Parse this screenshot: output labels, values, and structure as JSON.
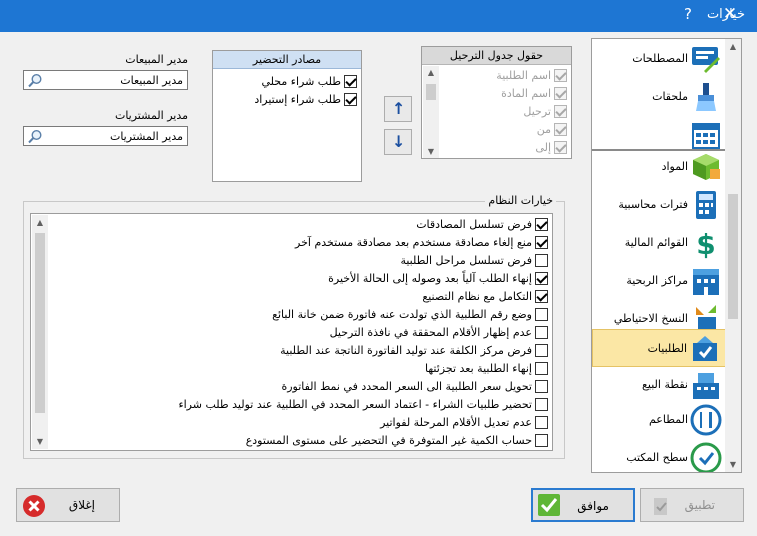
{
  "window": {
    "title": "خيارات",
    "help": "?",
    "close": "✕"
  },
  "sales_manager": {
    "label": "مدير المبيعات",
    "value": "مدير المبيعات"
  },
  "purchase_manager": {
    "label": "مدير المشتريات",
    "value": "مدير المشتريات"
  },
  "prep_sources": {
    "header": "مصادر التحضير",
    "items": [
      {
        "label": "طلب شراء محلي",
        "checked": true
      },
      {
        "label": "طلب شراء إستيراد",
        "checked": true
      }
    ]
  },
  "schedule_fields": {
    "header": "حقول جدول الترحيل",
    "items": [
      {
        "label": "اسم الطلبية",
        "checked": true
      },
      {
        "label": "اسم المادة",
        "checked": true
      },
      {
        "label": "ترحيل",
        "checked": true
      },
      {
        "label": "من",
        "checked": true
      },
      {
        "label": "إلى",
        "checked": true
      }
    ]
  },
  "arrows": {
    "up": "↑",
    "down": "↓"
  },
  "system_options": {
    "legend": "خيارات النظام",
    "items": [
      {
        "label": "فرض تسلسل المصادقات",
        "checked": true
      },
      {
        "label": "منع إلغاء مصادقة مستخدم بعد مصادقة مستخدم آخر",
        "checked": true
      },
      {
        "label": "فرض تسلسل مراحل الطلبية",
        "checked": false
      },
      {
        "label": "إنهاء الطلب آلياً بعد وصوله إلى الحالة الأخيرة",
        "checked": true
      },
      {
        "label": "التكامل مع نظام التصنيع",
        "checked": true
      },
      {
        "label": "وضع رقم الطلبية الذي تولدت عنه فاتورة ضمن خانة البائع",
        "checked": false
      },
      {
        "label": "عدم إظهار الأقلام المحققة في نافذة الترحيل",
        "checked": false
      },
      {
        "label": "فرض مركز الكلفة عند توليد الفاتورة الناتجة عند الطلبية",
        "checked": false
      },
      {
        "label": "إنهاء الطلبية بعد تجزئتها",
        "checked": false
      },
      {
        "label": "تحويل سعر الطلبية الى السعر المحدد في نمط الفاتورة",
        "checked": false
      },
      {
        "label": "تحضير طلبيات الشراء - اعتماد السعر المحدد في الطلبية عند توليد طلب شراء",
        "checked": false
      },
      {
        "label": "عدم تعديل الأقلام المرحلة لفواتير",
        "checked": false
      },
      {
        "label": "حساب الكمية غير المتوفرة في التحضير على مستوى المستودع",
        "checked": false
      }
    ]
  },
  "nav": {
    "items": [
      {
        "label": "المصطلحات",
        "icon": "terms-icon",
        "color": "#1c6fb8"
      },
      {
        "label": "ملحقات",
        "icon": "brush-icon",
        "color": "#1e4f8f"
      },
      {
        "label": "",
        "icon": "calendar-icon",
        "color": "#1c6fb8"
      },
      {
        "label": "المواد",
        "icon": "cube-icon",
        "color": "#6dbb2f"
      },
      {
        "label": "فترات محاسبية",
        "icon": "calculator-icon",
        "color": "#1c6fb8"
      },
      {
        "label": "القوائم المالية",
        "icon": "dollar-icon",
        "color": "#0f8f6f"
      },
      {
        "label": "مراكز الربحية",
        "icon": "building-icon",
        "color": "#1c6fb8"
      },
      {
        "label": "النسخ الاحتياطي",
        "icon": "backup-icon",
        "color": "#e08a1a"
      },
      {
        "label": "الطلبيات",
        "icon": "orders-icon",
        "color": "#1c6fb8",
        "selected": true
      },
      {
        "label": "نقطة البيع",
        "icon": "cash-register-icon",
        "color": "#1c6fb8"
      },
      {
        "label": "المطاعم",
        "icon": "restaurant-icon",
        "color": "#1c6fb8"
      },
      {
        "label": "سطح المكتب",
        "icon": "desktop-icon",
        "color": "#2a9a4a"
      }
    ]
  },
  "buttons": {
    "close": "إغلاق",
    "ok": "موافق",
    "apply": "تطبيق"
  },
  "colors": {
    "titlebar": "#1e76d3",
    "selection": "#fbe7a5",
    "accent": "#2b7bd0"
  }
}
